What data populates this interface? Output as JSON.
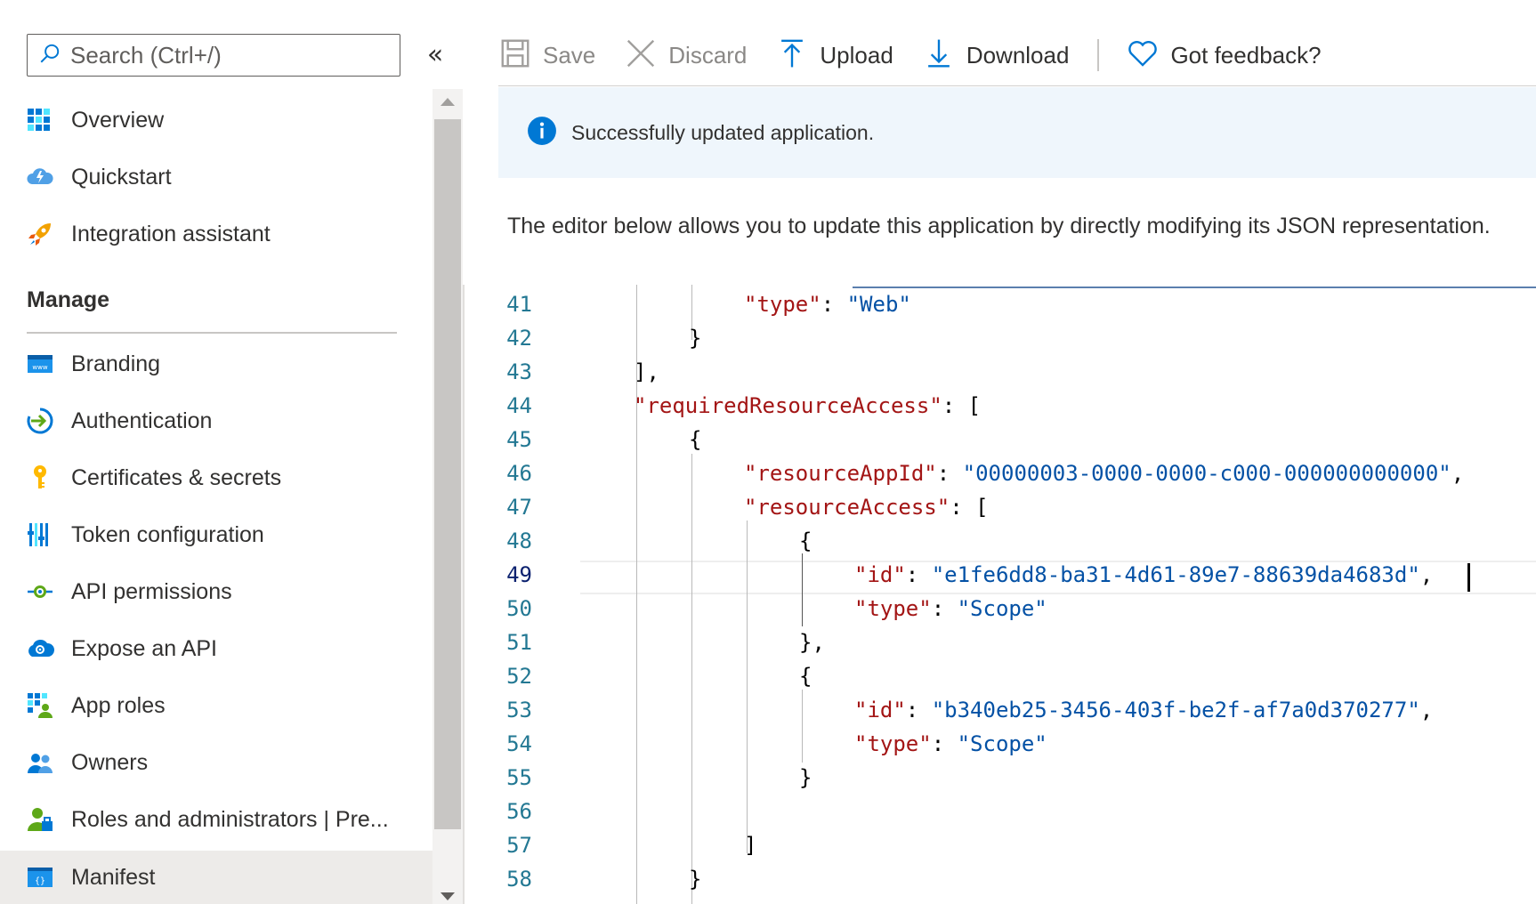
{
  "sidebar": {
    "search_placeholder": "Search (Ctrl+/)",
    "collapse_glyph": "«",
    "items_top": [
      {
        "label": "Overview",
        "icon": "overview-grid-icon"
      },
      {
        "label": "Quickstart",
        "icon": "quickstart-cloud-icon"
      },
      {
        "label": "Integration assistant",
        "icon": "rocket-icon"
      }
    ],
    "manage_header": "Manage",
    "items_manage": [
      {
        "label": "Branding",
        "icon": "branding-www-icon"
      },
      {
        "label": "Authentication",
        "icon": "authentication-arrow-icon"
      },
      {
        "label": "Certificates & secrets",
        "icon": "key-icon"
      },
      {
        "label": "Token configuration",
        "icon": "token-bars-icon"
      },
      {
        "label": "API permissions",
        "icon": "api-permissions-icon"
      },
      {
        "label": "Expose an API",
        "icon": "expose-api-cloud-icon"
      },
      {
        "label": "App roles",
        "icon": "app-roles-icon"
      },
      {
        "label": "Owners",
        "icon": "owners-people-icon"
      },
      {
        "label": "Roles and administrators | Pre...",
        "icon": "roles-admin-icon"
      },
      {
        "label": "Manifest",
        "icon": "manifest-braces-icon",
        "active": true
      }
    ]
  },
  "toolbar": {
    "save_label": "Save",
    "discard_label": "Discard",
    "upload_label": "Upload",
    "download_label": "Download",
    "feedback_label": "Got feedback?"
  },
  "notification": {
    "message": "Successfully updated application."
  },
  "description": "The editor below allows you to update this application by directly modifying its JSON representation.",
  "editor": {
    "lines": [
      {
        "n": "41",
        "text": "\"type\": \"Web\""
      },
      {
        "n": "42",
        "text": "}"
      },
      {
        "n": "43",
        "text": "],"
      },
      {
        "n": "44",
        "text": "\"requiredResourceAccess\": ["
      },
      {
        "n": "45",
        "text": "{"
      },
      {
        "n": "46",
        "text": "\"resourceAppId\": \"00000003-0000-0000-c000-000000000000\","
      },
      {
        "n": "47",
        "text": "\"resourceAccess\": ["
      },
      {
        "n": "48",
        "text": "{"
      },
      {
        "n": "49",
        "text": "\"id\": \"e1fe6dd8-ba31-4d61-89e7-88639da4683d\","
      },
      {
        "n": "50",
        "text": "\"type\": \"Scope\""
      },
      {
        "n": "51",
        "text": "},"
      },
      {
        "n": "52",
        "text": "{"
      },
      {
        "n": "53",
        "text": "\"id\": \"b340eb25-3456-403f-be2f-af7a0d370277\","
      },
      {
        "n": "54",
        "text": "\"type\": \"Scope\""
      },
      {
        "n": "55",
        "text": "}"
      },
      {
        "n": "56",
        "text": ""
      },
      {
        "n": "57",
        "text": "]"
      },
      {
        "n": "58",
        "text": "}"
      }
    ]
  },
  "colors": {
    "accent": "#0078d4",
    "json_key": "#a31515",
    "json_string": "#0451a5",
    "line_number": "#237893",
    "notice_bg": "#eff6fc"
  }
}
